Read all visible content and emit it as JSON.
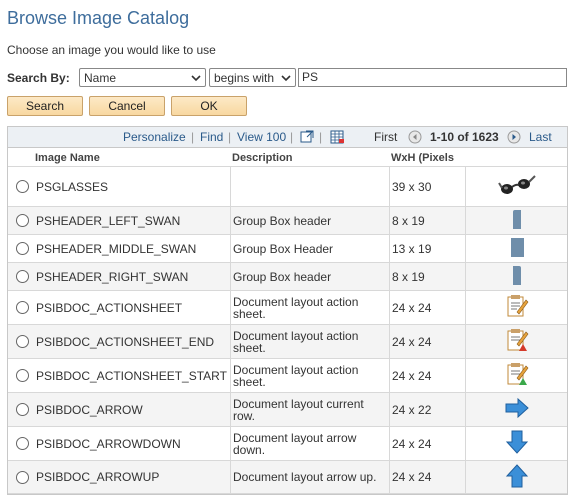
{
  "page": {
    "title": "Browse Image Catalog",
    "subtitle": "Choose an image you would like to use"
  },
  "search": {
    "label": "Search By:",
    "field_value": "Name",
    "operator_value": "begins with",
    "text_value": "PS"
  },
  "buttons": {
    "search": "Search",
    "cancel": "Cancel",
    "ok": "OK"
  },
  "grid": {
    "nav": {
      "personalize": "Personalize",
      "sep": "|",
      "find": "Find",
      "view100": "View 100",
      "first": "First",
      "range": "1-10 of 1623",
      "last": "Last"
    },
    "columns": {
      "name": "Image Name",
      "description": "Description",
      "size": "WxH (Pixels"
    },
    "rows": [
      {
        "name": "PSGLASSES",
        "description": "",
        "size": "39 x 30",
        "icon": "glasses-icon"
      },
      {
        "name": "PSHEADER_LEFT_SWAN",
        "description": "Group Box header",
        "size": "8 x 19",
        "icon": "header-left-swan-icon"
      },
      {
        "name": "PSHEADER_MIDDLE_SWAN",
        "description": "Group Box Header",
        "size": "13 x 19",
        "icon": "header-middle-swan-icon"
      },
      {
        "name": "PSHEADER_RIGHT_SWAN",
        "description": "Group Box header",
        "size": "8 x 19",
        "icon": "header-right-swan-icon"
      },
      {
        "name": "PSIBDOC_ACTIONSHEET",
        "description": "Document layout action sheet.",
        "size": "24 x 24",
        "icon": "actionsheet-icon"
      },
      {
        "name": "PSIBDOC_ACTIONSHEET_END",
        "description": "Document layout action sheet.",
        "size": "24 x 24",
        "icon": "actionsheet-end-icon"
      },
      {
        "name": "PSIBDOC_ACTIONSHEET_START",
        "description": "Document layout action sheet.",
        "size": "24 x 24",
        "icon": "actionsheet-start-icon"
      },
      {
        "name": "PSIBDOC_ARROW",
        "description": "Document layout current row.",
        "size": "24 x 22",
        "icon": "arrow-right-icon"
      },
      {
        "name": "PSIBDOC_ARROWDOWN",
        "description": "Document layout arrow down.",
        "size": "24 x 24",
        "icon": "arrow-down-icon"
      },
      {
        "name": "PSIBDOC_ARROWUP",
        "description": "Document layout arrow up.",
        "size": "24 x 24",
        "icon": "arrow-up-icon"
      }
    ]
  },
  "colors": {
    "title": "#3e6d9c",
    "link": "#2a5a8a",
    "button_bg": "#f8d8a1",
    "arrow_blue": "#3b8fd8"
  }
}
